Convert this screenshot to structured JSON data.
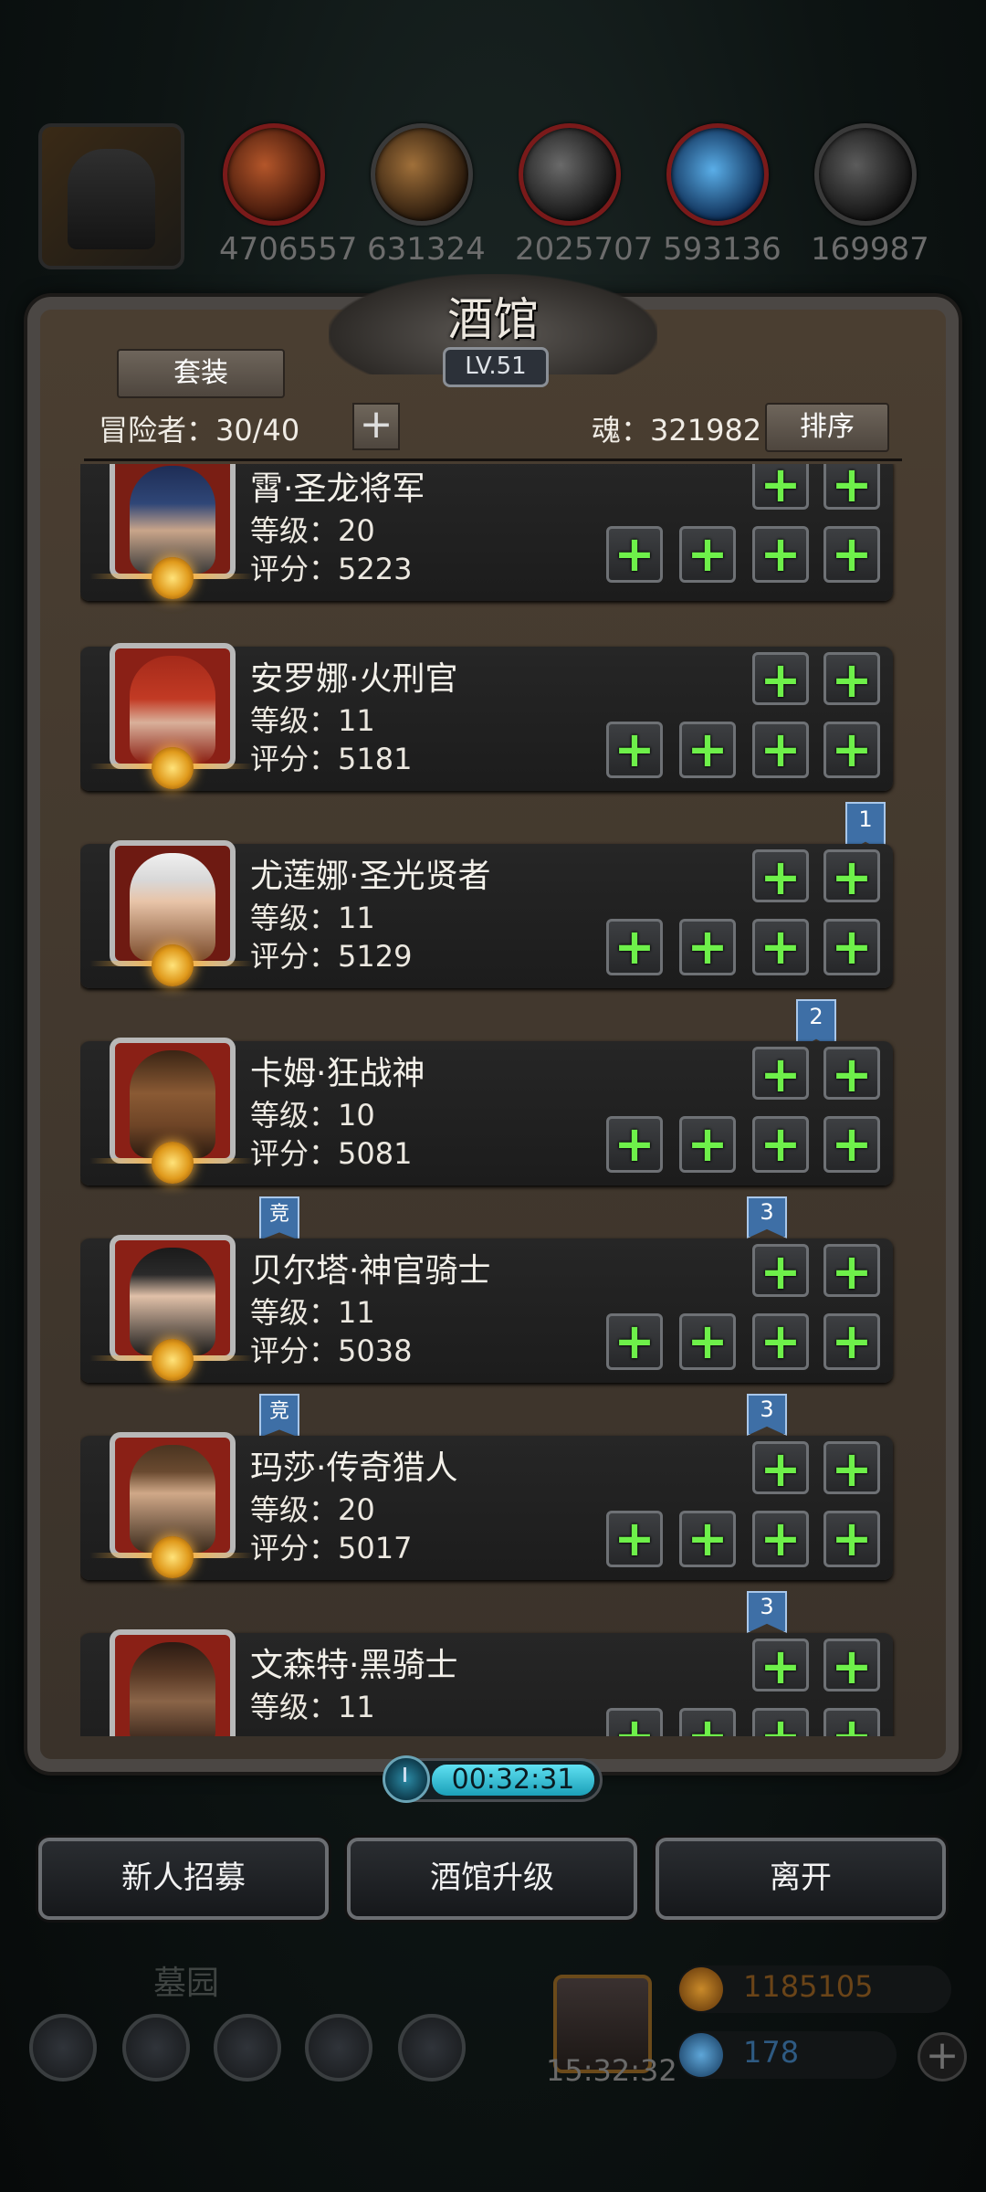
{
  "resources": [
    {
      "name": "profile",
      "value": ""
    },
    {
      "name": "leather",
      "value": "4706557"
    },
    {
      "name": "wood",
      "value": "631324"
    },
    {
      "name": "stone",
      "value": "2025707"
    },
    {
      "name": "crystal",
      "value": "593136"
    },
    {
      "name": "iron",
      "value": "169987"
    }
  ],
  "tavern": {
    "title": "酒馆",
    "level": "LV.51",
    "suit_label": "套装",
    "adventurers_label": "冒险者：30/40",
    "soul_label": "魂：321982",
    "sort_label": "排序",
    "plus_symbol": "+"
  },
  "heroes": [
    {
      "name": "霄·圣龙将军",
      "level": "等级：20",
      "score": "评分：5223"
    },
    {
      "name": "安罗娜·火刑官",
      "level": "等级：11",
      "score": "评分：5181"
    },
    {
      "name": "尤莲娜·圣光贤者",
      "level": "等级：11",
      "score": "评分：5129"
    },
    {
      "name": "卡姆·狂战神",
      "level": "等级：10",
      "score": "评分：5081"
    },
    {
      "name": "贝尔塔·神官骑士",
      "level": "等级：11",
      "score": "评分：5038"
    },
    {
      "name": "玛莎·传奇猎人",
      "level": "等级：20",
      "score": "评分：5017"
    },
    {
      "name": "文森特·黑骑士",
      "level": "等级：11",
      "score": ""
    }
  ],
  "flags": {
    "rank1": "1",
    "rank2": "2",
    "rank3": "3",
    "arena": "竞"
  },
  "timer": "00:32:31",
  "actions": {
    "recruit": "新人招募",
    "upgrade": "酒馆升级",
    "leave": "离开"
  },
  "background": {
    "graveyard": "墓园",
    "gift_timer": "15:32:32",
    "gold": "1185105",
    "gems": "178",
    "add_symbol": "+"
  },
  "colors": {
    "plus_green": "#6ef04a",
    "flag_blue": "#3e6fa6",
    "timer_cyan": "#5fe1f2",
    "portrait_red": "#8a2016"
  }
}
